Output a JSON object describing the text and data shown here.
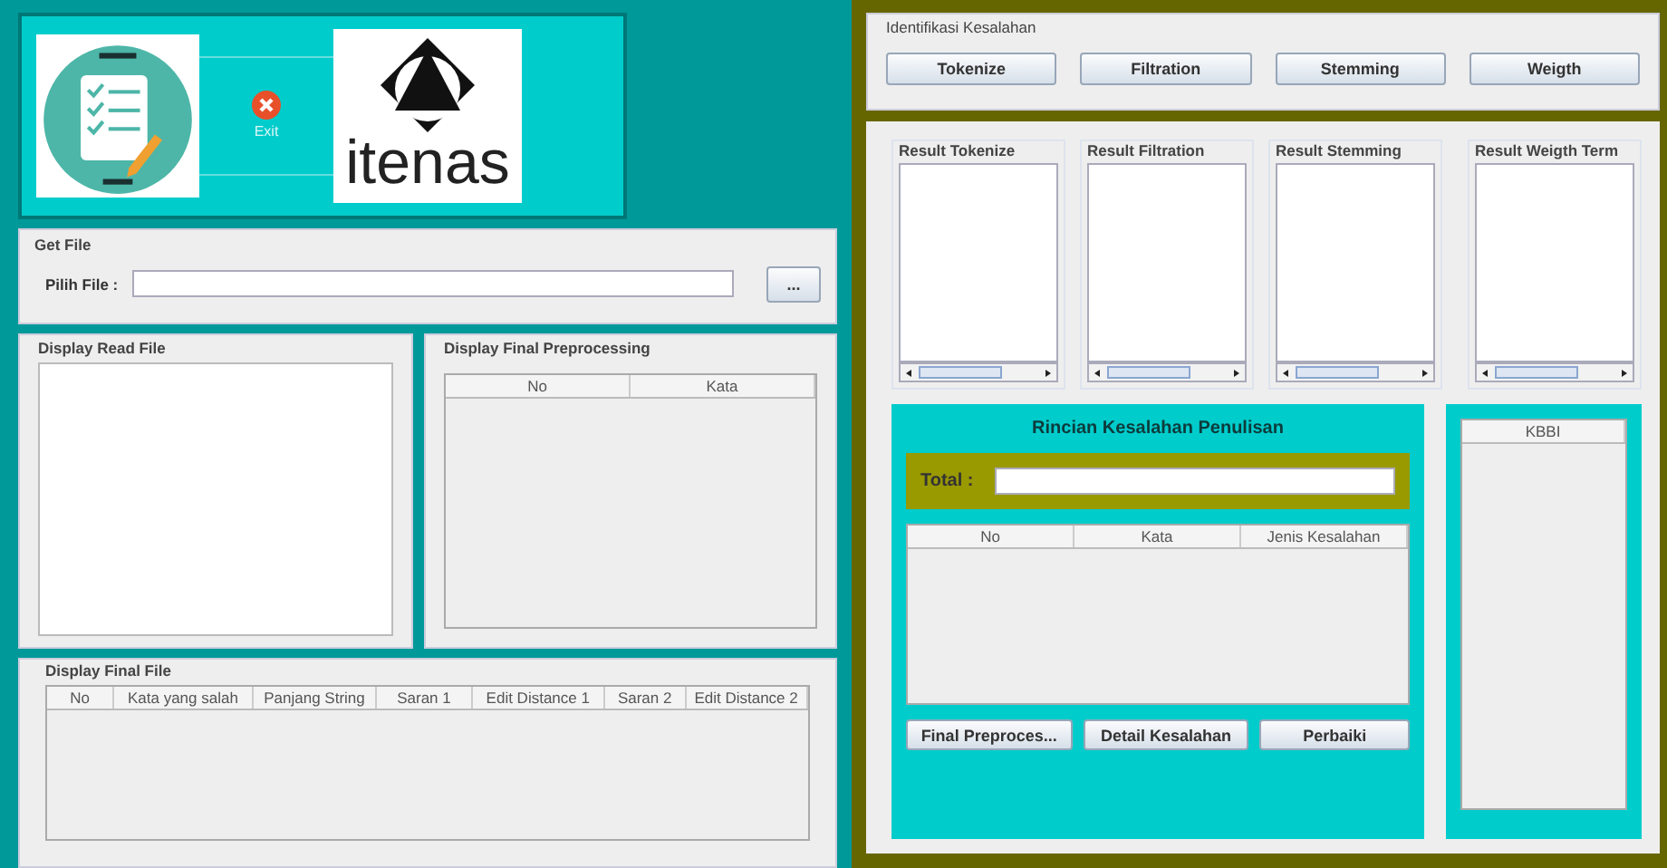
{
  "header": {
    "exit_label": "Exit",
    "logo_text": "itenas"
  },
  "get_file": {
    "title": "Get File",
    "label": "Pilih File :",
    "browse_button": "..."
  },
  "read_file": {
    "title": "Display Read File"
  },
  "final_preprocessing": {
    "title": "Display Final Preprocessing",
    "columns": [
      "No",
      "Kata"
    ]
  },
  "final_file": {
    "title": "Display Final File",
    "columns": [
      "No",
      "Kata yang salah",
      "Panjang String",
      "Saran 1",
      "Edit Distance 1",
      "Saran 2",
      "Edit Distance 2"
    ]
  },
  "identification": {
    "title": "Identifikasi Kesalahan",
    "buttons": [
      "Tokenize",
      "Filtration",
      "Stemming",
      "Weigth"
    ]
  },
  "results": [
    {
      "title": "Result Tokenize"
    },
    {
      "title": "Result Filtration"
    },
    {
      "title": "Result Stemming"
    },
    {
      "title": "Result Weigth Term"
    }
  ],
  "details": {
    "title": "Rincian Kesalahan Penulisan",
    "total_label": "Total :",
    "columns": [
      "No",
      "Kata",
      "Jenis Kesalahan"
    ],
    "buttons": [
      "Final Preproces...",
      "Detail Kesalahan",
      "Perbaiki"
    ]
  },
  "kbbi": {
    "columns": [
      "KBBI"
    ]
  }
}
